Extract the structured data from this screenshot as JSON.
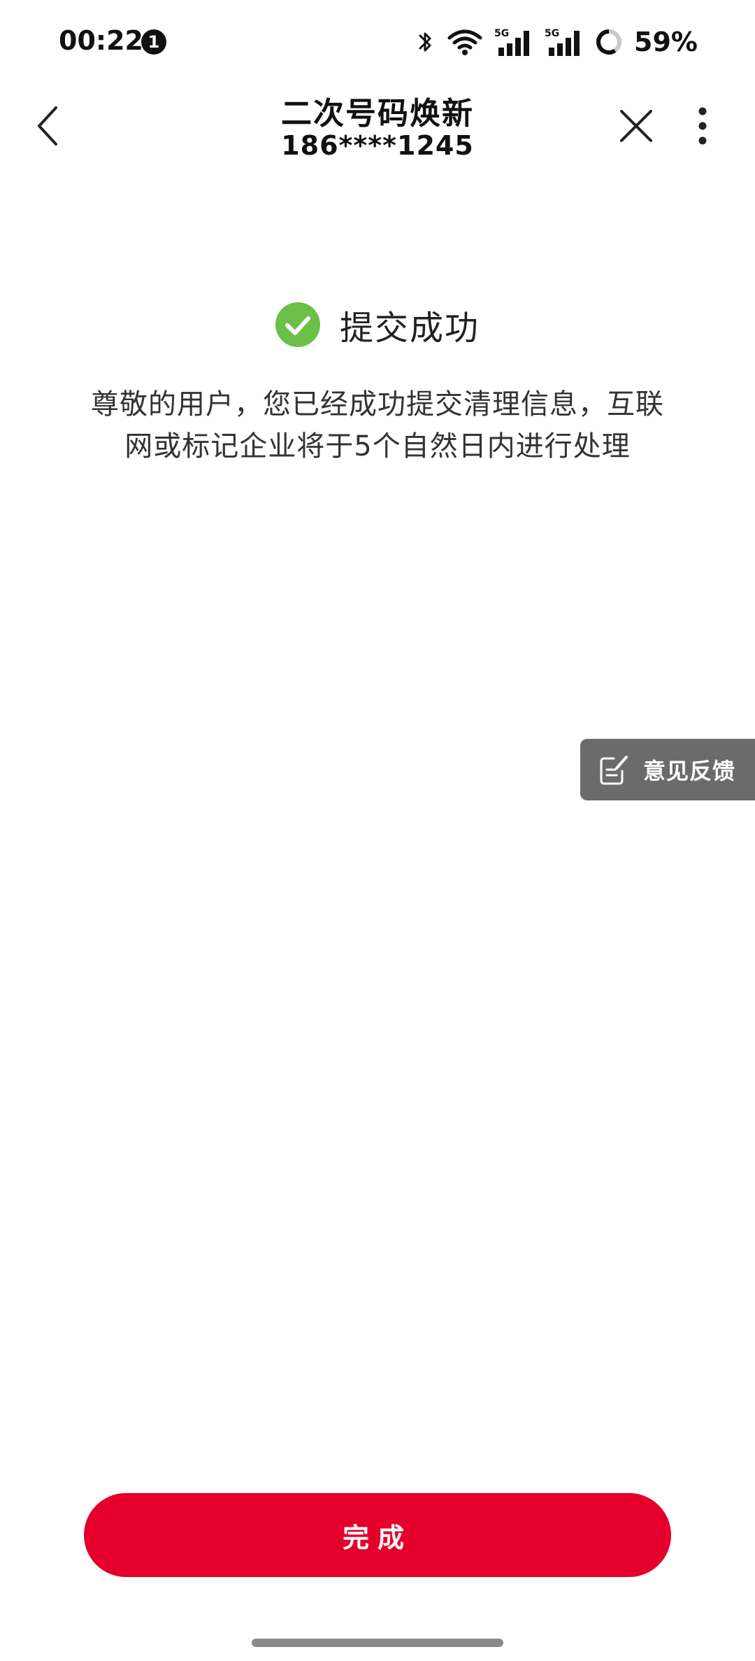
{
  "status_bar": {
    "time": "00:22",
    "notification_count": "1",
    "network_labels": [
      "5G",
      "5G"
    ],
    "battery": "59%"
  },
  "nav": {
    "title": "二次号码焕新",
    "subtitle": "186****1245"
  },
  "result": {
    "title": "提交成功",
    "message": "尊敬的用户，您已经成功提交清理信息，互联网或标记企业将于5个自然日内进行处理",
    "icon": "check-circle-icon"
  },
  "feedback": {
    "label": "意见反馈",
    "icon": "edit-note-icon"
  },
  "footer": {
    "done_label": "完成"
  },
  "colors": {
    "primary": "#e4002b",
    "success": "#6cc04a",
    "feedback_bg": "#6b6b6b"
  }
}
